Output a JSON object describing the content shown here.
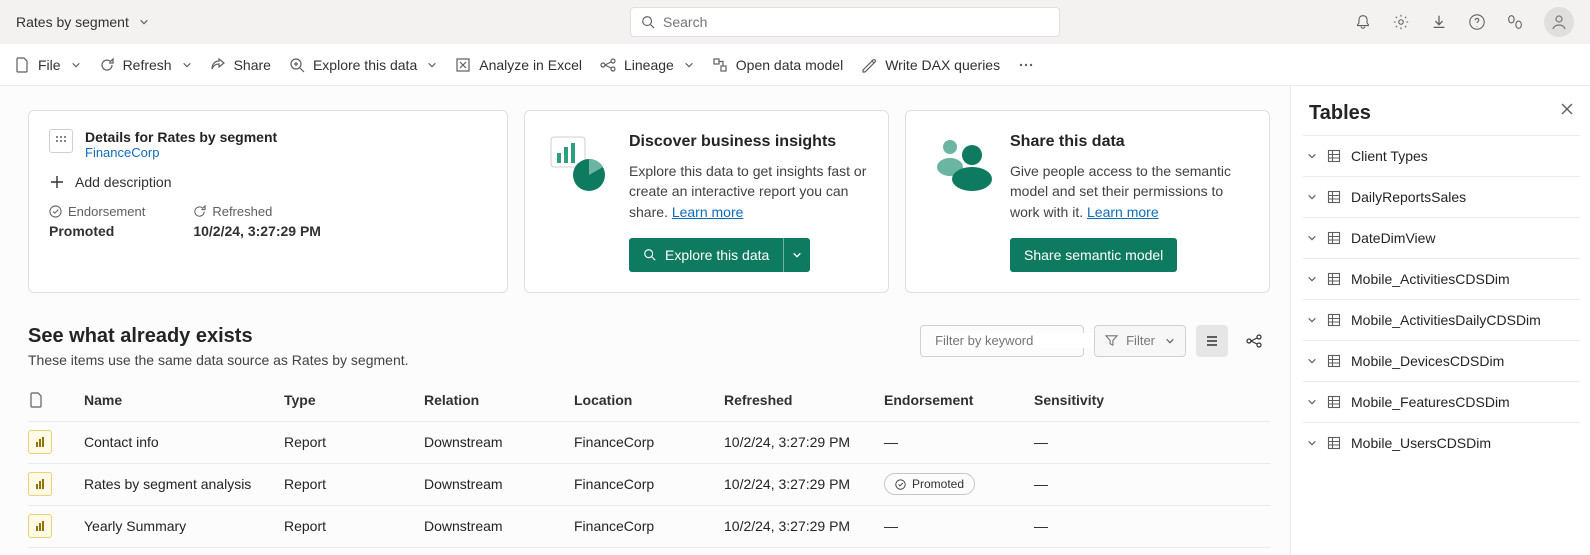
{
  "header": {
    "title": "Rates by segment",
    "search_placeholder": "Search"
  },
  "toolbar": {
    "file": "File",
    "refresh": "Refresh",
    "share": "Share",
    "explore": "Explore this data",
    "analyze_excel": "Analyze in Excel",
    "lineage": "Lineage",
    "open_model": "Open data model",
    "write_dax": "Write DAX queries"
  },
  "details": {
    "title": "Details for Rates by segment",
    "workspace": "FinanceCorp",
    "add_description": "Add description",
    "endorsement_lbl": "Endorsement",
    "endorsement_val": "Promoted",
    "refreshed_lbl": "Refreshed",
    "refreshed_val": "10/2/24, 3:27:29 PM"
  },
  "insights": {
    "title": "Discover business insights",
    "desc": "Explore this data to get insights fast or create an interactive report you can share. ",
    "learn_more": "Learn more",
    "button": "Explore this data"
  },
  "share": {
    "title": "Share this data",
    "desc": "Give people access to the semantic model and set their permissions to work with it. ",
    "learn_more": "Learn more",
    "button": "Share semantic model"
  },
  "related": {
    "title": "See what already exists",
    "subtitle": "These items use the same data source as Rates by segment.",
    "filter_placeholder": "Filter by keyword",
    "filter_btn": "Filter",
    "columns": {
      "name": "Name",
      "type": "Type",
      "relation": "Relation",
      "location": "Location",
      "refreshed": "Refreshed",
      "endorsement": "Endorsement",
      "sensitivity": "Sensitivity"
    },
    "rows": [
      {
        "name": "Contact info",
        "type": "Report",
        "relation": "Downstream",
        "location": "FinanceCorp",
        "refreshed": "10/2/24, 3:27:29 PM",
        "endorsement": "—",
        "sensitivity": "—"
      },
      {
        "name": "Rates by segment analysis",
        "type": "Report",
        "relation": "Downstream",
        "location": "FinanceCorp",
        "refreshed": "10/2/24, 3:27:29 PM",
        "endorsement": "Promoted",
        "sensitivity": "—"
      },
      {
        "name": "Yearly Summary",
        "type": "Report",
        "relation": "Downstream",
        "location": "FinanceCorp",
        "refreshed": "10/2/24, 3:27:29 PM",
        "endorsement": "—",
        "sensitivity": "—"
      }
    ]
  },
  "tables": {
    "title": "Tables",
    "items": [
      "Client Types",
      "DailyReportsSales",
      "DateDimView",
      "Mobile_ActivitiesCDSDim",
      "Mobile_ActivitiesDailyCDSDim",
      "Mobile_DevicesCDSDim",
      "Mobile_FeaturesCDSDim",
      "Mobile_UsersCDSDim"
    ]
  }
}
